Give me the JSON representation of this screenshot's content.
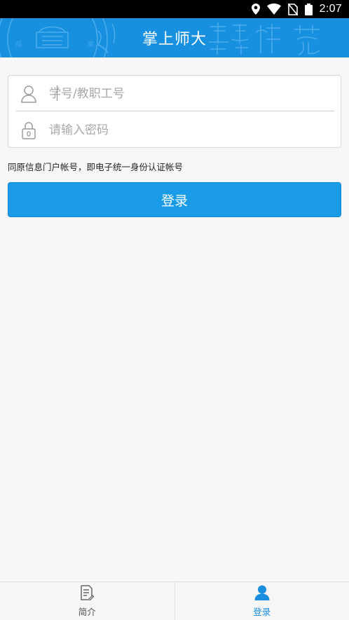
{
  "status_bar": {
    "time": "2:07",
    "icons": [
      "location-icon",
      "wifi-icon",
      "no-sim-icon",
      "battery-icon"
    ]
  },
  "app_bar": {
    "title": "掌上师大"
  },
  "login_form": {
    "username": {
      "placeholder": "学号/教职工号",
      "value": "",
      "icon": "user-icon"
    },
    "password": {
      "placeholder": "请输入密码",
      "value": "",
      "icon": "lock-icon"
    }
  },
  "hint_text": "同原信息门户帐号，即电子统一身份认证帐号",
  "login_button": {
    "label": "登录"
  },
  "bottom_nav": {
    "items": [
      {
        "label": "简介",
        "icon": "document-icon",
        "active": false
      },
      {
        "label": "登录",
        "icon": "person-icon",
        "active": true
      }
    ]
  },
  "colors": {
    "accent": "#1a9be8",
    "app_bar": "#1890e0",
    "background": "#f7f7f7"
  }
}
